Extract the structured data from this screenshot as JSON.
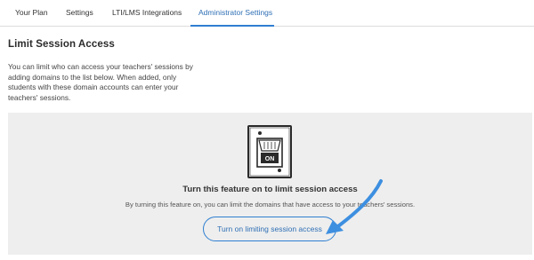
{
  "tabs": [
    {
      "label": "Your Plan"
    },
    {
      "label": "Settings"
    },
    {
      "label": "LTI/LMS Integrations"
    },
    {
      "label": "Administrator Settings"
    }
  ],
  "section": {
    "title": "Limit Session Access",
    "description": "You can limit who can access your teachers' sessions by adding domains to the list below. When added, only students with these domain accounts can enter your teachers' sessions."
  },
  "feature": {
    "icon_label": "ON",
    "title": "Turn this feature on to limit session access",
    "description": "By turning this feature on, you can limit the domains that have access to your teachers' sessions.",
    "button_label": "Turn on limiting session access"
  },
  "colors": {
    "accent": "#2f7fd1",
    "panel_bg": "#eeeeee",
    "arrow": "#3d8fe0"
  },
  "icons": [
    "switch-on-icon",
    "callout-arrow-icon"
  ]
}
